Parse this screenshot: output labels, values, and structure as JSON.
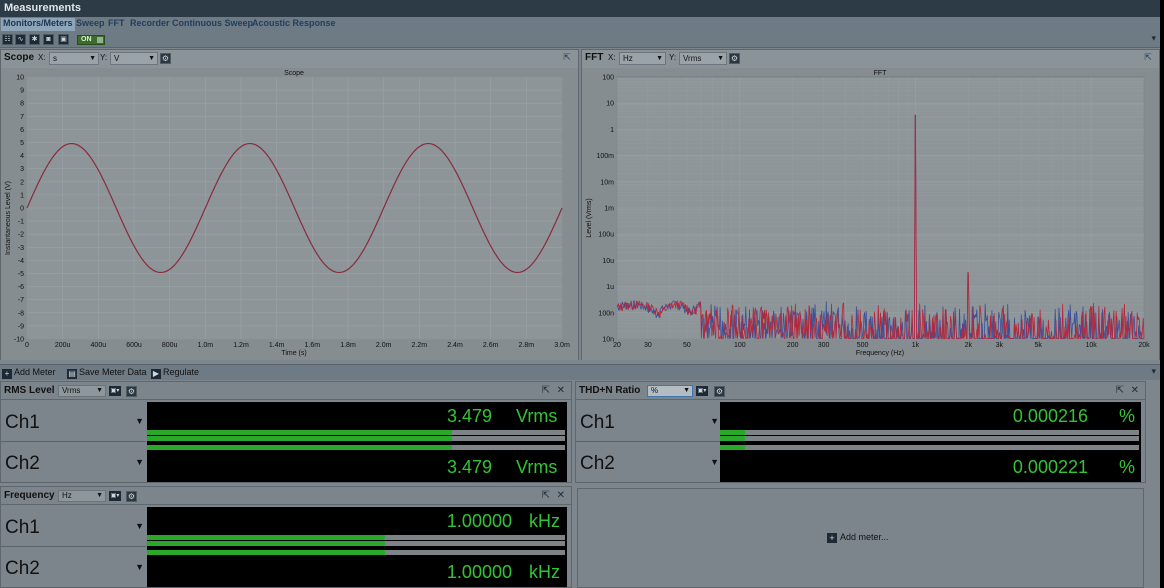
{
  "app": {
    "title": "Measurements"
  },
  "menu": {
    "tabs": [
      "Monitors/Meters",
      "Sweep",
      "FFT",
      "Recorder",
      "Continuous Sweep",
      "Acoustic Response"
    ],
    "active": "Monitors/Meters"
  },
  "toolbar": {
    "toggle_label": "ON",
    "icons": [
      "grid-icon",
      "signal-icon",
      "bluetooth-icon",
      "disk-icon",
      "chart-icon"
    ],
    "icon_glyphs": [
      "☷",
      "∿",
      "✱",
      "◙",
      "▣"
    ]
  },
  "scope": {
    "panel_title": "Scope",
    "x_label_prefix": "X:",
    "x_unit": "s",
    "y_label_prefix": "Y:",
    "y_unit": "V",
    "graph_title": "Scope",
    "xlabel": "Time (s)",
    "ylabel": "Instantaneous Level (V)"
  },
  "fft": {
    "panel_title": "FFT",
    "x_label_prefix": "X:",
    "x_unit": "Hz",
    "y_label_prefix": "Y:",
    "y_unit": "Vrms",
    "graph_title": "FFT",
    "xlabel": "Frequency (Hz)",
    "ylabel": "Level (Vrms)"
  },
  "chart_data": [
    {
      "type": "line",
      "title": "Scope",
      "xlabel": "Time (s)",
      "ylabel": "Instantaneous Level (V)",
      "xlim": [
        0,
        0.003
      ],
      "ylim": [
        -10,
        10
      ],
      "x_tick_labels": [
        "0",
        "200u",
        "400u",
        "600u",
        "800u",
        "1.0m",
        "1.2m",
        "1.4m",
        "1.6m",
        "1.8m",
        "2.0m",
        "2.2m",
        "2.4m",
        "2.6m",
        "2.8m",
        "3.0m"
      ],
      "y_tick_labels": [
        "10",
        "9",
        "8",
        "7",
        "6",
        "5",
        "4",
        "3",
        "2",
        "1",
        "0",
        "-1",
        "-2",
        "-3",
        "-4",
        "-5",
        "-6",
        "-7",
        "-8",
        "-9",
        "-10"
      ],
      "grid": true,
      "series": [
        {
          "color": "#8a2a3a",
          "amplitude": 4.92,
          "frequency_hz": 1000,
          "x": [
            0,
            0.00025,
            0.0005,
            0.00075,
            0.001,
            0.00125,
            0.0015,
            0.00175,
            0.002,
            0.00225,
            0.0025,
            0.00275,
            0.003
          ],
          "y": [
            0,
            4.92,
            0,
            -4.92,
            0,
            4.92,
            0,
            -4.92,
            0,
            4.92,
            0,
            -4.92,
            0
          ]
        }
      ]
    },
    {
      "type": "line",
      "title": "FFT",
      "xlabel": "Frequency (Hz)",
      "ylabel": "Level (Vrms)",
      "x_scale": "log",
      "y_scale": "log",
      "xlim": [
        20,
        20000
      ],
      "ylim": [
        1e-08,
        100
      ],
      "x_tick_labels": [
        "20",
        "30",
        "50",
        "100",
        "200",
        "300",
        "500",
        "1k",
        "2k",
        "3k",
        "5k",
        "10k",
        "20k"
      ],
      "x_tick_values": [
        20,
        30,
        50,
        100,
        200,
        300,
        500,
        1000,
        2000,
        3000,
        5000,
        10000,
        20000
      ],
      "y_tick_labels": [
        "100",
        "10",
        "1",
        "100m",
        "10m",
        "1m",
        "100u",
        "10u",
        "1u",
        "100n",
        "10n"
      ],
      "y_tick_values": [
        100,
        10,
        1,
        0.1,
        0.01,
        0.001,
        0.0001,
        1e-05,
        1e-06,
        1e-07,
        1e-08
      ],
      "grid": true,
      "series": [
        {
          "color": "#b5283a",
          "peaks": [
            {
              "x": 1000,
              "y": 3.479
            },
            {
              "x": 2000,
              "y": 3.5e-06
            }
          ],
          "noise_floor": 1e-07
        },
        {
          "color": "#3a4f9a",
          "peaks": [
            {
              "x": 1000,
              "y": 3.479
            },
            {
              "x": 2000,
              "y": 3e-06
            }
          ],
          "noise_floor": 1e-07
        }
      ]
    }
  ],
  "meter_toolbar": {
    "add_meter": "Add Meter",
    "save_meter_data": "Save Meter Data",
    "regulate": "Regulate"
  },
  "meters": {
    "rms": {
      "title": "RMS Level",
      "unit_select": "Vrms",
      "channels": [
        {
          "label": "Ch1",
          "value": "3.479",
          "unit": "Vrms",
          "level": 0.73
        },
        {
          "label": "Ch2",
          "value": "3.479",
          "unit": "Vrms",
          "level": 0.73
        }
      ]
    },
    "thdn": {
      "title": "THD+N Ratio",
      "unit_select": "%",
      "channels": [
        {
          "label": "Ch1",
          "value": "0.000216",
          "unit": "%",
          "level": 0.06
        },
        {
          "label": "Ch2",
          "value": "0.000221",
          "unit": "%",
          "level": 0.06
        }
      ]
    },
    "freq": {
      "title": "Frequency",
      "unit_select": "Hz",
      "channels": [
        {
          "label": "Ch1",
          "value": "1.00000",
          "unit": "kHz",
          "level": 0.57
        },
        {
          "label": "Ch2",
          "value": "1.00000",
          "unit": "kHz",
          "level": 0.57
        }
      ]
    },
    "add_slot": {
      "label": "Add meter..."
    }
  },
  "colors": {
    "readout_text": "#33c433",
    "bar_fill": "#2aa82a",
    "scope_trace": "#8a2a3a",
    "fft_ch1": "#b5283a",
    "fft_ch2": "#3a4f9a"
  }
}
